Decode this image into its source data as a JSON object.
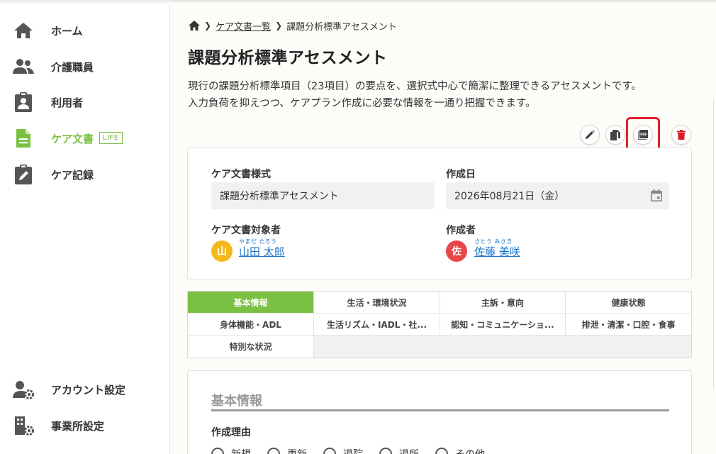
{
  "nav": {
    "home": "ホーム",
    "staff": "介護職員",
    "users": "利用者",
    "care_docs": "ケア文書",
    "care_docs_badge": "LIFE",
    "care_records": "ケア記録",
    "account_settings": "アカウント設定",
    "office_settings": "事業所設定"
  },
  "breadcrumb": {
    "list": "ケア文書一覧",
    "current": "課題分析標準アセスメント"
  },
  "page": {
    "title": "課題分析標準アセスメント",
    "description_1": "現行の課題分析標準項目（23項目）の要点を、選択式中心で簡潔に整理できるアセスメントです。",
    "description_2": "入力負荷を抑えつつ、ケアプラン作成に必要な情報を一通り把握できます。"
  },
  "actions": [
    "edit",
    "copy",
    "pdf",
    "delete"
  ],
  "info": {
    "style_label": "ケア文書様式",
    "style_value": "課題分析標準アセスメント",
    "date_label": "作成日",
    "date_value": "2026年08月21日（金）",
    "subject_label": "ケア文書対象者",
    "subject_initial": "山",
    "subject_ruby": "やまだ たろう",
    "subject_name": "山田 太郎",
    "author_label": "作成者",
    "author_initial": "佐",
    "author_ruby": "さとう みさき",
    "author_name": "佐藤 美咲"
  },
  "tabs": [
    {
      "label": "基本情報",
      "active": true
    },
    {
      "label": "生活・環境状況"
    },
    {
      "label": "主訴・意向"
    },
    {
      "label": "健康状態"
    },
    {
      "label": "身体機能・ADL"
    },
    {
      "label": "生活リズム・IADL・社..."
    },
    {
      "label": "認知・コミュニケーショ..."
    },
    {
      "label": "排泄・清潔・口腔・食事"
    },
    {
      "label": "特別な状況"
    }
  ],
  "section": {
    "title": "基本情報",
    "reason_label": "作成理由",
    "options": [
      "新規",
      "更新",
      "退院",
      "退所",
      "その他"
    ]
  },
  "colors": {
    "accent": "#7ac143",
    "link": "#1a73c9",
    "highlight": "#e0202c",
    "subject_avatar": "#f5b81c",
    "author_avatar": "#e8474a",
    "delete": "#d81e2a"
  }
}
